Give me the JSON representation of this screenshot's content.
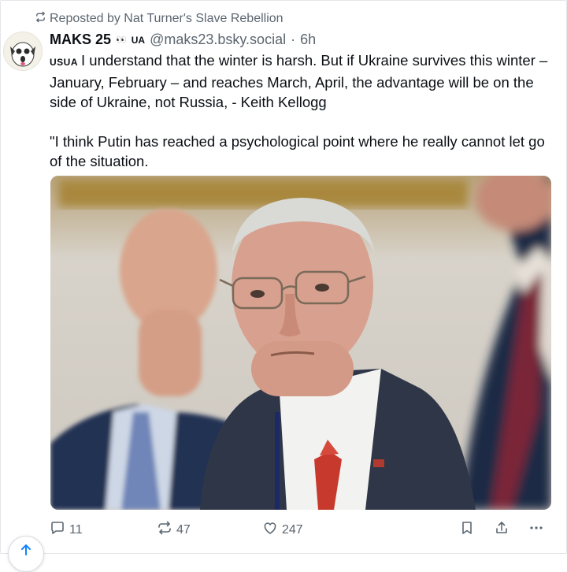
{
  "repost": {
    "label": "Reposted by Nat Turner's Slave Rebellion",
    "icon": "repost-icon"
  },
  "author": {
    "name": "MAKS 25",
    "emoji": "👀",
    "flag": "UA",
    "handle": "@maks23.bsky.social",
    "separator": "·",
    "time": "6h"
  },
  "post": {
    "prefix": "USUA",
    "line1": "I understand that the winter is harsh. But if Ukraine survives this winter – January, February – and reaches March, April, the advantage will be on the side of Ukraine, not Russia, - Keith Kellogg",
    "line2": "\"I think Putin has reached a psychological point where he really cannot let go of the situation."
  },
  "actions": {
    "replies": "11",
    "reposts": "47",
    "likes": "247"
  },
  "colors": {
    "muted": "#5b6670",
    "text": "#0b0f14",
    "tie": "#c8392d",
    "suit": "#26324a"
  }
}
